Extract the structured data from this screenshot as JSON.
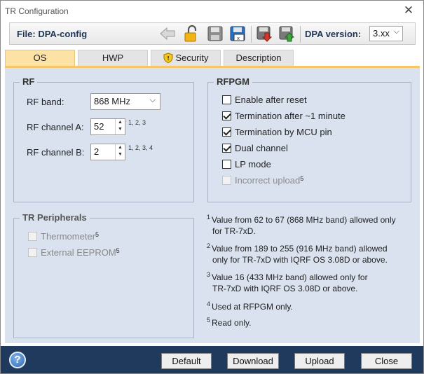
{
  "window": {
    "title": "TR Configuration",
    "close": "✕"
  },
  "toolbar": {
    "file_label": "File: DPA-config",
    "icons": [
      "back-arrow-icon",
      "unlock-icon",
      "save-icon",
      "save-as-icon",
      "download-icon",
      "upload-icon"
    ],
    "dpa_version_label": "DPA version:",
    "dpa_version_value": "3.xx"
  },
  "tabs": [
    {
      "label": "OS",
      "active": true
    },
    {
      "label": "HWP",
      "active": false
    },
    {
      "label": "Security",
      "active": false,
      "icon": "shield-icon"
    },
    {
      "label": "Description",
      "active": false
    }
  ],
  "rf": {
    "title": "RF",
    "band_label": "RF band:",
    "band_value": "868 MHz",
    "channel_a_label": "RF channel A:",
    "channel_a_value": "52",
    "channel_a_footnotes": "1, 2, 3",
    "channel_b_label": "RF channel B:",
    "channel_b_value": "2",
    "channel_b_footnotes": "1, 2, 3, 4"
  },
  "rfpgm": {
    "title": "RFPGM",
    "options": [
      {
        "label": "Enable after reset",
        "checked": false,
        "disabled": false
      },
      {
        "label": "Termination after ~1 minute",
        "checked": true,
        "disabled": false
      },
      {
        "label": "Termination by MCU pin",
        "checked": true,
        "disabled": false
      },
      {
        "label": "Dual channel",
        "checked": true,
        "disabled": false
      },
      {
        "label": "LP mode",
        "checked": false,
        "disabled": false
      },
      {
        "label": "Incorrect upload",
        "checked": false,
        "disabled": true,
        "footnote": "5"
      }
    ]
  },
  "peripherals": {
    "title": "TR Peripherals",
    "options": [
      {
        "label": "Thermometer",
        "checked": false,
        "disabled": true,
        "footnote": "5"
      },
      {
        "label": "External EEPROM",
        "checked": false,
        "disabled": true,
        "footnote": "5"
      }
    ]
  },
  "notes": [
    {
      "num": "1",
      "text": "Value from 62 to 67 (868 MHz band) allowed only",
      "text2": "for TR-7xD."
    },
    {
      "num": "2",
      "text": "Value from 189 to 255 (916 MHz band) allowed",
      "text2": "only for TR-7xD with IQRF OS 3.08D or above."
    },
    {
      "num": "3",
      "text": "Value 16 (433 MHz band) allowed only for",
      "text2": "TR-7xD with IQRF OS 3.08D or above."
    },
    {
      "num": "4",
      "text": "Used at RFPGM only.",
      "text2": ""
    },
    {
      "num": "5",
      "text": "Read only.",
      "text2": ""
    }
  ],
  "footer": {
    "help": "?",
    "buttons": [
      "Default",
      "Download",
      "Upload",
      "Close"
    ]
  }
}
